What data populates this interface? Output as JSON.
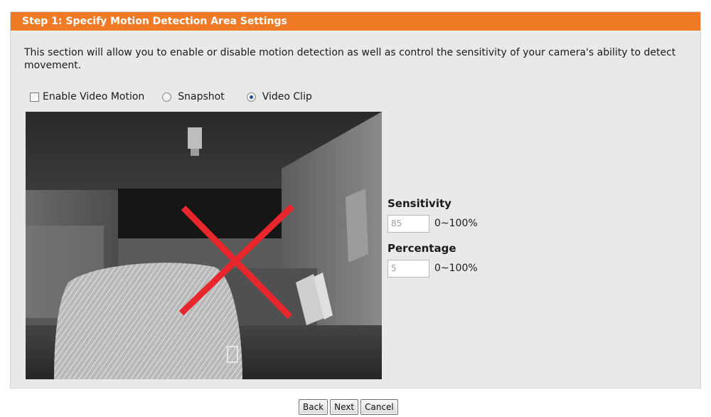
{
  "panel": {
    "title": "Step 1: Specify Motion Detection Area Settings",
    "description": "This section will allow you to enable or disable motion detection as well as control the sensitivity of your camera's ability to detect movement."
  },
  "options": {
    "enable_video_motion": {
      "label": "Enable Video Motion",
      "checked": false
    },
    "snapshot": {
      "label": "Snapshot",
      "selected": false
    },
    "video_clip": {
      "label": "Video Clip",
      "selected": true
    }
  },
  "settings": {
    "sensitivity": {
      "label": "Sensitivity",
      "value": "85",
      "range": "0~100%"
    },
    "percentage": {
      "label": "Percentage",
      "value": "5",
      "range": "0~100%"
    }
  },
  "buttons": {
    "back": "Back",
    "next": "Next",
    "cancel": "Cancel"
  },
  "colors": {
    "header": "#f07a25",
    "panel_bg": "#e9e9e9",
    "disabled_mark": "#e8262b"
  },
  "icons": {
    "disabled": "red-x-icon"
  }
}
